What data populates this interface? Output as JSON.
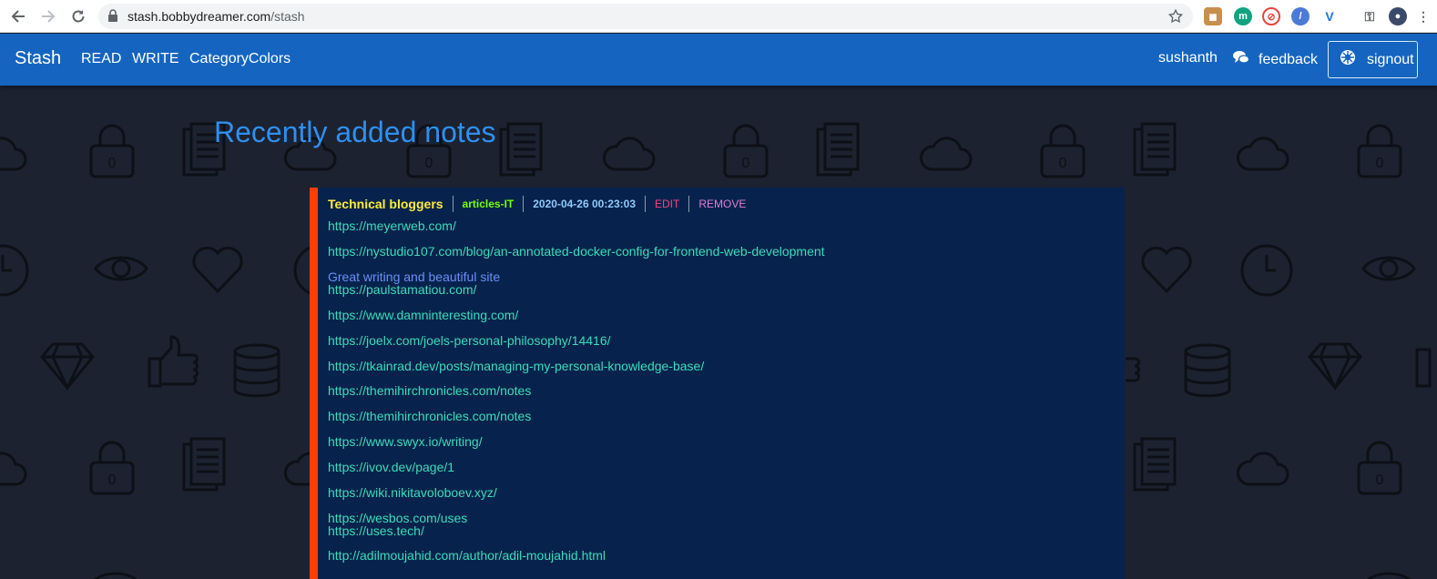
{
  "browser": {
    "url_host": "stash.bobbydreamer.com",
    "url_path": "/stash"
  },
  "appbar": {
    "brand": "Stash",
    "nav": [
      "READ",
      "WRITE",
      "CategoryColors"
    ],
    "user": "sushanth",
    "feedback": "feedback",
    "signout": "signout"
  },
  "page": {
    "heading": "Recently added notes"
  },
  "note": {
    "title": "Technical bloggers",
    "category": "articles-IT",
    "datetime": "2020-04-26 00:23:03",
    "edit": "EDIT",
    "remove": "REMOVE",
    "lines": [
      "https://meyerweb.com/",
      "https://nystudio107.com/blog/an-annotated-docker-config-for-frontend-web-development",
      "Great writing and beautiful site",
      "https://paulstamatiou.com/",
      "https://www.damninteresting.com/",
      "https://joelx.com/joels-personal-philosophy/14416/",
      "https://tkainrad.dev/posts/managing-my-personal-knowledge-base/",
      "https://themihirchronicles.com/notes",
      "https://themihirchronicles.com/notes",
      "https://www.swyx.io/writing/",
      "https://ivov.dev/page/1",
      "https://wiki.nikitavoloboev.xyz/",
      "https://wesbos.com/uses",
      "https://uses.tech/",
      "http://adilmoujahid.com/author/adil-moujahid.html"
    ]
  },
  "colors": {
    "appbar": "#1565c0",
    "accent_bar": "#ff3d00",
    "card_bg": "#07234d",
    "link": "#3ddbb8"
  }
}
